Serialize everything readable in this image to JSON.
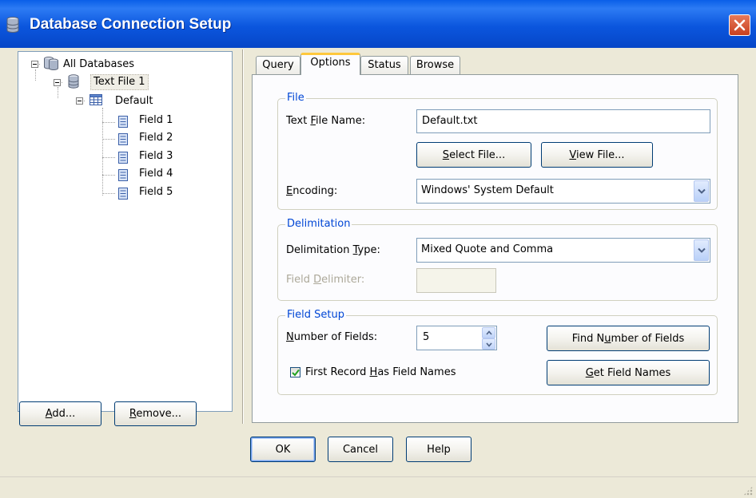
{
  "window": {
    "title": "Database Connection Setup",
    "icon": "database-icon"
  },
  "tree": {
    "root": {
      "label": "All Databases",
      "icon": "databases-icon"
    },
    "source": {
      "label": "Text File 1",
      "icon": "database-icon"
    },
    "table": {
      "label": "Default",
      "icon": "table-icon"
    },
    "fields": [
      {
        "label": "Field 1",
        "icon": "field-icon"
      },
      {
        "label": "Field 2",
        "icon": "field-icon"
      },
      {
        "label": "Field 3",
        "icon": "field-icon"
      },
      {
        "label": "Field 4",
        "icon": "field-icon"
      },
      {
        "label": "Field 5",
        "icon": "field-icon"
      }
    ]
  },
  "left_buttons": {
    "add": {
      "pre": "",
      "acc": "A",
      "post": "dd..."
    },
    "remove": {
      "pre": "",
      "acc": "R",
      "post": "emove..."
    }
  },
  "tabs": [
    {
      "label": "Query"
    },
    {
      "label": "Options"
    },
    {
      "label": "Status"
    },
    {
      "label": "Browse"
    }
  ],
  "file_group": {
    "title": "File",
    "name_label": {
      "pre": "Text ",
      "acc": "F",
      "post": "ile Name:"
    },
    "name_value": "Default.txt",
    "select_button": {
      "pre": "",
      "acc": "S",
      "post": "elect File..."
    },
    "view_button": {
      "pre": "",
      "acc": "V",
      "post": "iew File..."
    },
    "encoding_label": {
      "pre": "",
      "acc": "E",
      "post": "ncoding:"
    },
    "encoding_value": "Windows' System Default"
  },
  "delimitation_group": {
    "title": "Delimitation",
    "type_label": {
      "pre": "Delimitation ",
      "acc": "T",
      "post": "ype:"
    },
    "type_value": "Mixed Quote and Comma",
    "delimiter_label": {
      "pre": "Field ",
      "acc": "D",
      "post": "elimiter:"
    },
    "delimiter_value": ""
  },
  "field_setup_group": {
    "title": "Field Setup",
    "count_label": {
      "pre": "",
      "acc": "N",
      "post": "umber of Fields:"
    },
    "count_value": "5",
    "first_record": {
      "pre": "First Record ",
      "acc": "H",
      "post": "as Field Names",
      "checked": true
    },
    "find_button": {
      "pre": "Find N",
      "acc": "u",
      "post": "mber of Fields"
    },
    "get_button": {
      "pre": "",
      "acc": "G",
      "post": "et Field Names"
    }
  },
  "dialog_buttons": {
    "ok": "OK",
    "cancel": "Cancel",
    "help": "Help"
  },
  "colors": {
    "title_bar": "#0A5FE8",
    "group_title": "#0046D5",
    "active_tab_accent": "#FFC83C",
    "dialog_bg": "#ECE9D8"
  }
}
